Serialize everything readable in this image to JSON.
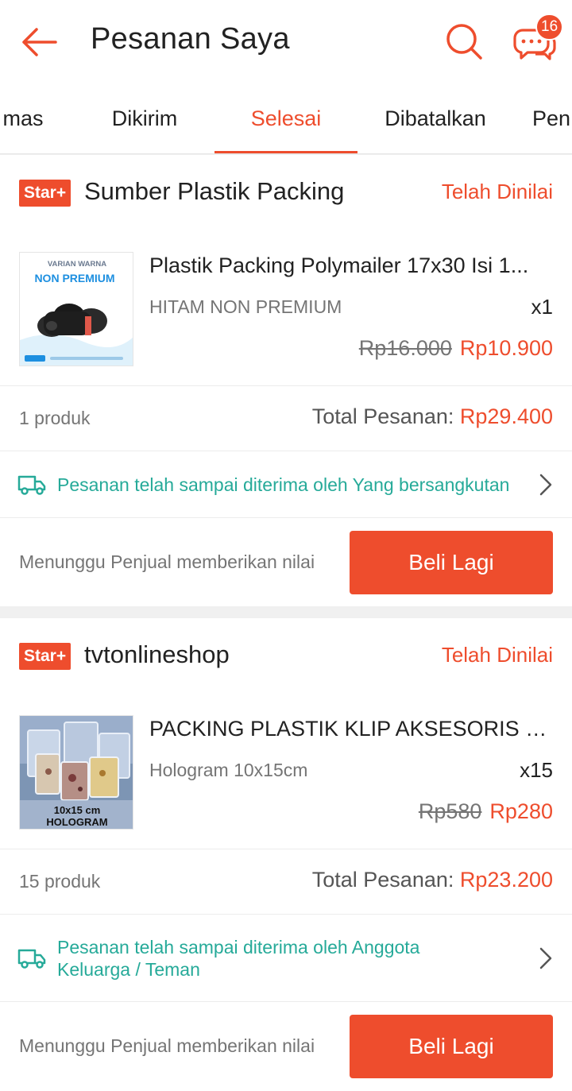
{
  "header": {
    "title": "Pesanan Saya",
    "chat_badge": "16"
  },
  "tabs": [
    {
      "label": "mas"
    },
    {
      "label": "Dikirim"
    },
    {
      "label": "Selesai"
    },
    {
      "label": "Dibatalkan"
    },
    {
      "label": "Pen"
    }
  ],
  "orders": [
    {
      "badge": "Star+",
      "shop": "Sumber Plastik Packing",
      "status": "Telah Dinilai",
      "product": {
        "name": "Plastik Packing Polymailer 17x30 Isi 1...",
        "variant": "HITAM NON PREMIUM",
        "qty": "x1",
        "price_old": "Rp16.000",
        "price_new": "Rp10.900",
        "thumb_top": "VARIAN WARNA",
        "thumb_main": "NON PREMIUM"
      },
      "count": "1 produk",
      "total_label": "Total Pesanan: ",
      "total_value": "Rp29.400",
      "delivery": "Pesanan telah sampai diterima oleh Yang bersangkutan",
      "wait": "Menunggu Penjual memberikan nilai",
      "button": "Beli Lagi"
    },
    {
      "badge": "Star+",
      "shop": "tvtonlineshop",
      "status": "Telah Dinilai",
      "product": {
        "name": "PACKING PLASTIK KLIP AKSESORIS ZI...",
        "variant": "Hologram 10x15cm",
        "qty": "x15",
        "price_old": "Rp580",
        "price_new": "Rp280",
        "thumb_line1": "10x15 cm",
        "thumb_line2": "HOLOGRAM"
      },
      "count": "15 produk",
      "total_label": "Total Pesanan: ",
      "total_value": "Rp23.200",
      "delivery_line1": "Pesanan telah sampai diterima oleh Anggota",
      "delivery_line2": "Keluarga / Teman",
      "wait": "Menunggu Penjual memberikan nilai",
      "button": "Beli Lagi"
    }
  ],
  "colors": {
    "brand": "#ee4d2d",
    "delivery": "#26aa99"
  }
}
